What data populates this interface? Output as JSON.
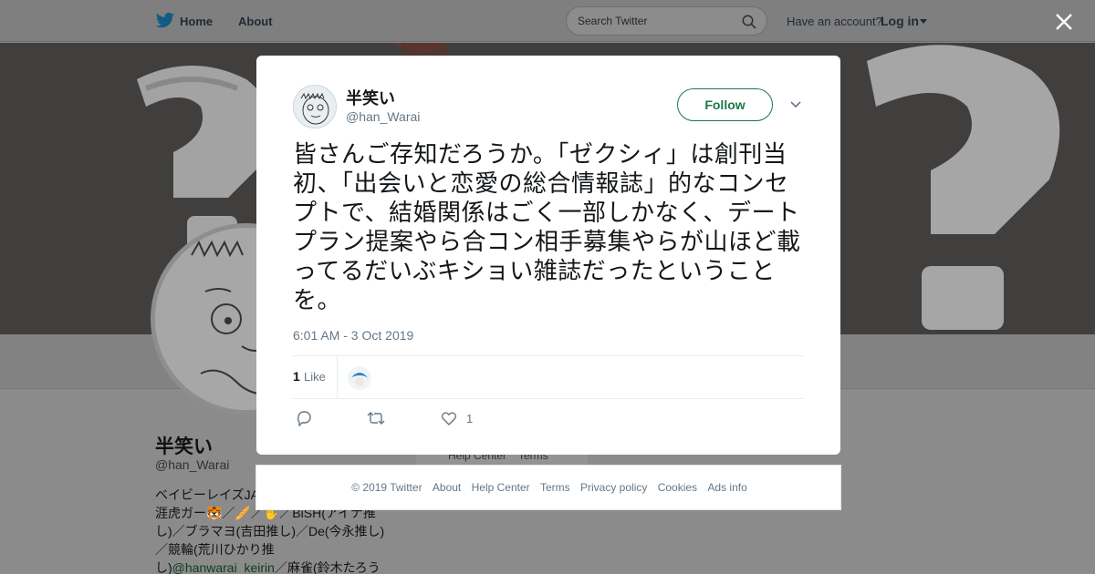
{
  "nav": {
    "home_label": "Home",
    "about_label": "About",
    "search_placeholder": "Search Twitter",
    "have_account": "Have an account?",
    "login_label": "Log in"
  },
  "profile": {
    "name": "半笑い",
    "handle": "@han_Warai",
    "bio_lines": [
      "ベイビーレイズJA",
      "涯虎ガー🐯／🥖／✋／BiSH(アイナ推",
      "し)／ブラマヨ(吉田推し)／De(今永推し)",
      "／競輪(荒川ひかり推",
      "し)"
    ],
    "bio_link": "@hanwarai_keirin",
    "bio_after_link": "／麻雀(鈴木たろう"
  },
  "background_footer": {
    "help_center": "Help Center",
    "terms": "Terms"
  },
  "tweet": {
    "user_name": "半笑い",
    "user_handle": "@han_Warai",
    "follow_label": "Follow",
    "text": "皆さんご存知だろうか。「ゼクシィ」は創刊当初、「出会いと恋愛の総合情報誌」的なコンセプトで、結婚関係はごく一部しかなく、デートプラン提案やら合コン相手募集やらが山ほど載ってるだいぶキショい雑誌だったということを。",
    "timestamp": "6:01 AM - 3 Oct 2019",
    "likes_count": "1",
    "likes_label": "Like",
    "like_action_count": "1"
  },
  "footer": {
    "copyright": "© 2019 Twitter",
    "about": "About",
    "help_center": "Help Center",
    "terms": "Terms",
    "privacy": "Privacy policy",
    "cookies": "Cookies",
    "ads_info": "Ads info"
  },
  "colors": {
    "follow_green": "#1b7a48",
    "twitter_blue": "#1da1f2",
    "secondary_text": "#657786"
  },
  "icons": [
    "twitter-bird-icon",
    "search-icon",
    "close-icon",
    "chevron-down-icon",
    "reply-icon",
    "retweet-icon",
    "heart-icon"
  ]
}
